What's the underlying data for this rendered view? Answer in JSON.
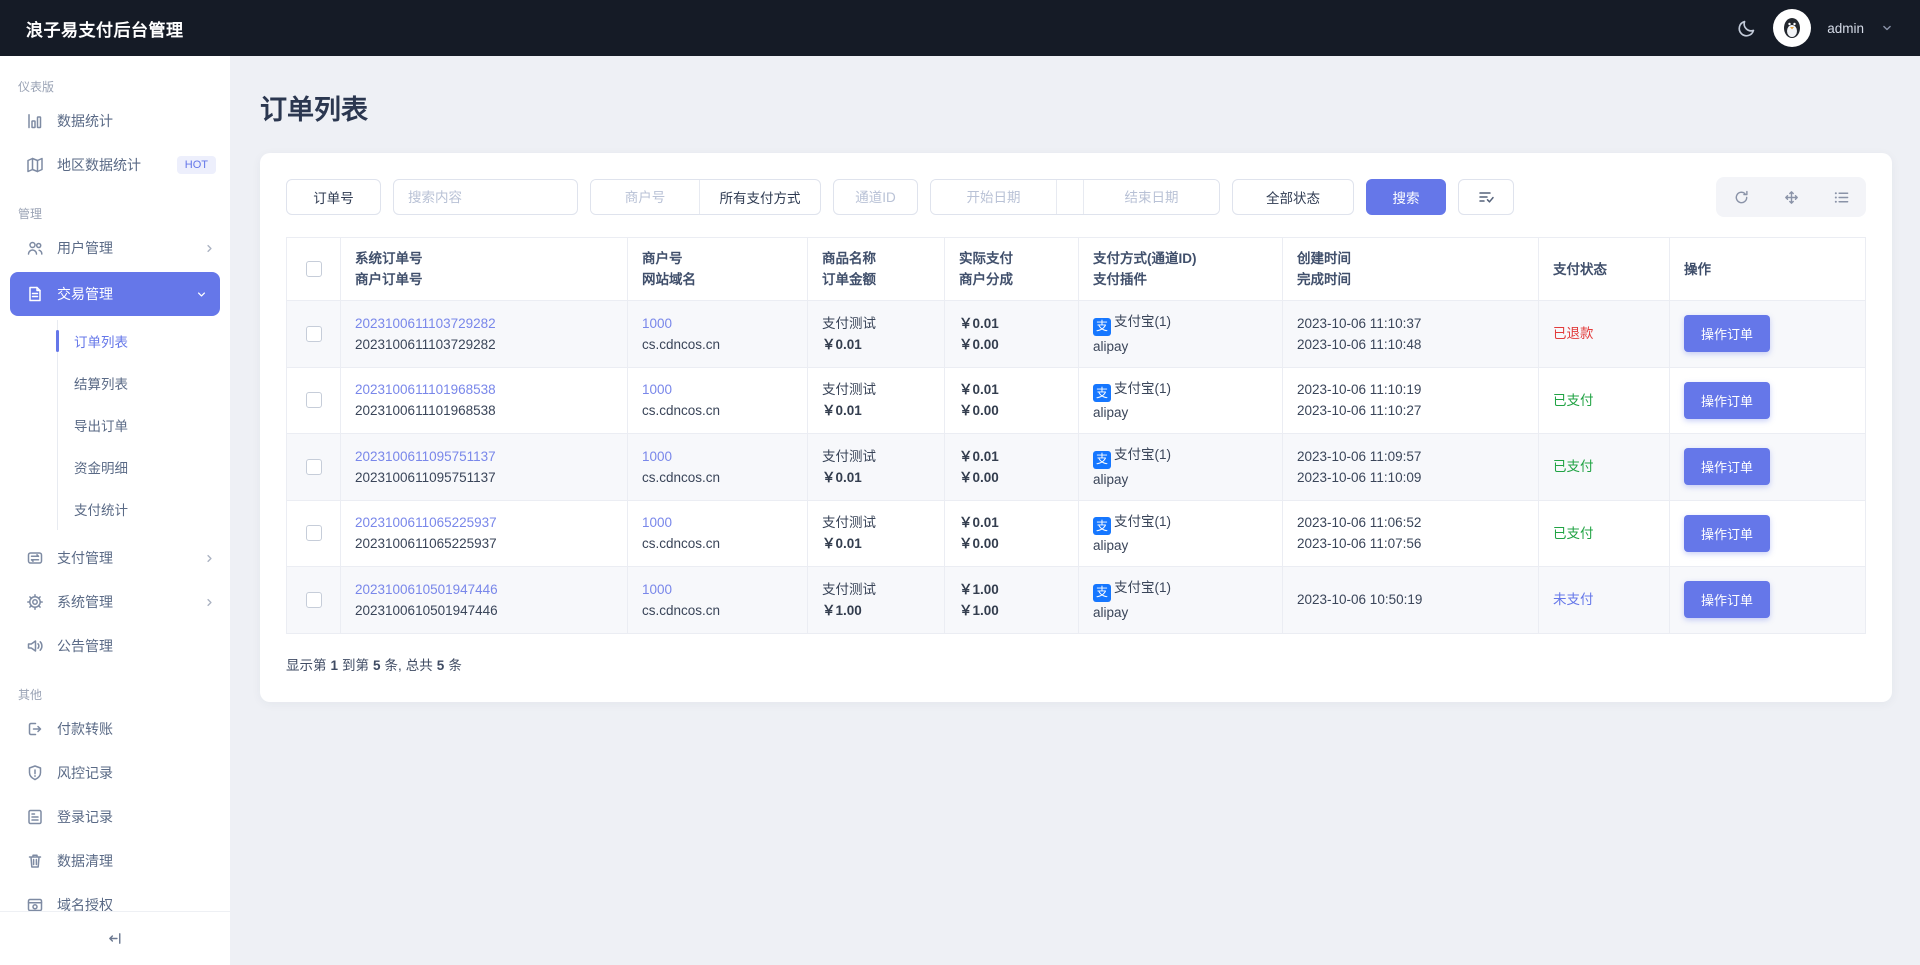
{
  "theme": {
    "accent": "#6577e9",
    "link_color": "#7987ea",
    "topbar_bg": "#151b26",
    "status_refunded_color": "#e23b3b",
    "status_paid_color": "#21a344",
    "status_unpaid_color": "#6577e9",
    "alipay_blue": "#1677ff",
    "hot_badge_bg": "#edeffc",
    "hot_badge_text": "#6577e9"
  },
  "icons": {
    "topbar": [
      "crescent-moon-icon",
      "avatar",
      "chevron-down-icon"
    ],
    "toolbar": [
      "refresh-icon",
      "expand-arrows-icon",
      "column-list-icon"
    ],
    "filter_button": "filter-check-icon",
    "sidebar_collapse": "collapse-arrow-icon",
    "payment": "alipay-icon"
  },
  "topbar": {
    "title": "浪子易支付后台管理",
    "username": "admin"
  },
  "sidebar": {
    "sections": [
      {
        "label": "仪表版",
        "items": [
          {
            "label": "数据统计",
            "icon": "bar-chart-icon"
          },
          {
            "label": "地区数据统计",
            "icon": "map-icon",
            "badge": "HOT"
          }
        ]
      },
      {
        "label": "管理",
        "items": [
          {
            "label": "用户管理",
            "icon": "users-icon"
          },
          {
            "label": "交易管理",
            "icon": "file-text-icon",
            "children": [
              "订单列表",
              "结算列表",
              "导出订单",
              "资金明细",
              "支付统计"
            ]
          },
          {
            "label": "支付管理",
            "icon": "transfer-icon"
          },
          {
            "label": "系统管理",
            "icon": "gear-icon"
          },
          {
            "label": "公告管理",
            "icon": "speaker-icon"
          }
        ]
      },
      {
        "label": "其他",
        "items": [
          {
            "label": "付款转账",
            "icon": "send-icon"
          },
          {
            "label": "风控记录",
            "icon": "shield-icon"
          },
          {
            "label": "登录记录",
            "icon": "log-icon"
          },
          {
            "label": "数据清理",
            "icon": "trash-icon"
          },
          {
            "label": "域名授权",
            "icon": "domain-icon"
          }
        ]
      }
    ]
  },
  "page": {
    "title": "订单列表"
  },
  "filters": {
    "order_type": "订单号",
    "search_placeholder": "搜索内容",
    "merchant_placeholder": "商户号",
    "pay_method": "所有支付方式",
    "channel_placeholder": "通道ID",
    "start_date_placeholder": "开始日期",
    "end_date_placeholder": "结束日期",
    "status": "全部状态",
    "search_button": "搜索"
  },
  "table": {
    "columns": [
      [
        "系统订单号",
        "商户订单号"
      ],
      [
        "商户号",
        "网站域名"
      ],
      [
        "商品名称",
        "订单金额"
      ],
      [
        "实际支付",
        "商户分成"
      ],
      [
        "支付方式(通道ID)",
        "支付插件"
      ],
      [
        "创建时间",
        "完成时间"
      ],
      [
        "支付状态"
      ],
      [
        "操作"
      ]
    ],
    "action_label": "操作订单",
    "alipay_glyph": "支",
    "rows": [
      {
        "sys_order": "2023100611103729282",
        "merchant_order": "2023100611103729282",
        "merchant_id": "1000",
        "domain": "cs.cdncos.cn",
        "product": "支付测试",
        "order_amount": "￥0.01",
        "paid": "￥0.01",
        "merchant_share": "￥0.00",
        "pay_method": "支付宝(1)",
        "plugin": "alipay",
        "created": "2023-10-06 11:10:37",
        "completed": "2023-10-06 11:10:48",
        "status": "已退款"
      },
      {
        "sys_order": "2023100611101968538",
        "merchant_order": "2023100611101968538",
        "merchant_id": "1000",
        "domain": "cs.cdncos.cn",
        "product": "支付测试",
        "order_amount": "￥0.01",
        "paid": "￥0.01",
        "merchant_share": "￥0.00",
        "pay_method": "支付宝(1)",
        "plugin": "alipay",
        "created": "2023-10-06 11:10:19",
        "completed": "2023-10-06 11:10:27",
        "status": "已支付"
      },
      {
        "sys_order": "2023100611095751137",
        "merchant_order": "2023100611095751137",
        "merchant_id": "1000",
        "domain": "cs.cdncos.cn",
        "product": "支付测试",
        "order_amount": "￥0.01",
        "paid": "￥0.01",
        "merchant_share": "￥0.00",
        "pay_method": "支付宝(1)",
        "plugin": "alipay",
        "created": "2023-10-06 11:09:57",
        "completed": "2023-10-06 11:10:09",
        "status": "已支付"
      },
      {
        "sys_order": "2023100611065225937",
        "merchant_order": "2023100611065225937",
        "merchant_id": "1000",
        "domain": "cs.cdncos.cn",
        "product": "支付测试",
        "order_amount": "￥0.01",
        "paid": "￥0.01",
        "merchant_share": "￥0.00",
        "pay_method": "支付宝(1)",
        "plugin": "alipay",
        "created": "2023-10-06 11:06:52",
        "completed": "2023-10-06 11:07:56",
        "status": "已支付"
      },
      {
        "sys_order": "2023100610501947446",
        "merchant_order": "2023100610501947446",
        "merchant_id": "1000",
        "domain": "cs.cdncos.cn",
        "product": "支付测试",
        "order_amount": "￥1.00",
        "paid": "￥1.00",
        "merchant_share": "￥1.00",
        "pay_method": "支付宝(1)",
        "plugin": "alipay",
        "created": "2023-10-06 10:50:19",
        "completed": "",
        "status": "未支付"
      }
    ]
  },
  "pagination": {
    "parts": [
      "显示第",
      "1",
      "到第",
      "5",
      "条,",
      "总共",
      "5",
      "条"
    ]
  }
}
